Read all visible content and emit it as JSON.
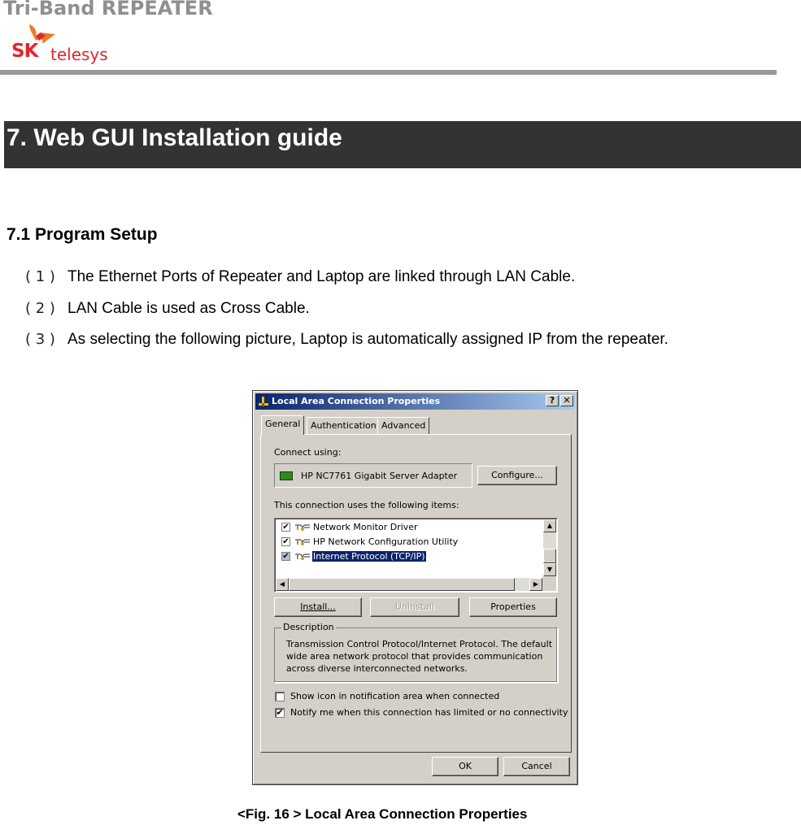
{
  "header": {
    "product_title": "Tri-Band REPEATER",
    "logo_brand": "SK",
    "logo_sub": "telesys",
    "colors": {
      "title_gray": "#8f8f8f",
      "logo_red": "#e3262d",
      "logo_orange": "#f07a1d",
      "rule": "#999999"
    }
  },
  "section": {
    "title": "7. Web GUI Installation guide",
    "bar_color": "#333333"
  },
  "subsection": {
    "title": "7.1  Program Setup",
    "steps": [
      {
        "num": "( 1 )",
        "text": "The Ethernet Ports of Repeater and Laptop are linked through LAN Cable."
      },
      {
        "num": "( 2 )",
        "text": "LAN Cable is used as Cross Cable."
      },
      {
        "num": "( 3 )",
        "text": "As selecting the following picture, Laptop is automatically assigned IP from the repeater."
      }
    ]
  },
  "dialog": {
    "title": "Local Area Connection Properties",
    "help_label": "?",
    "close_label": "✕",
    "tabs": [
      {
        "label": "General",
        "active": true
      },
      {
        "label": "Authentication",
        "active": false
      },
      {
        "label": "Advanced",
        "active": false
      }
    ],
    "connect_using_label": "Connect using:",
    "adapter_name": "HP NC7761 Gigabit Server Adapter",
    "configure_label": "Configure...",
    "items_label": "This connection uses the following items:",
    "items": [
      {
        "label": "Network Monitor Driver",
        "checked": true,
        "selected": false
      },
      {
        "label": "HP Network Configuration Utility",
        "checked": true,
        "selected": false
      },
      {
        "label": "Internet Protocol (TCP/IP)",
        "checked": true,
        "selected": true
      }
    ],
    "install_label": "Install...",
    "uninstall_label": "Uninstall",
    "properties_label": "Properties",
    "description_label": "Description",
    "description_text": "Transmission Control Protocol/Internet Protocol. The default wide area network protocol that provides communication across diverse interconnected networks.",
    "show_icon_label": "Show icon in notification area when connected",
    "show_icon_checked": false,
    "notify_label": "Notify me when this connection has limited or no connectivity",
    "notify_checked": true,
    "ok_label": "OK",
    "cancel_label": "Cancel",
    "check_glyph": "✔"
  },
  "caption": "<Fig. 16 > Local Area Connection Properties"
}
